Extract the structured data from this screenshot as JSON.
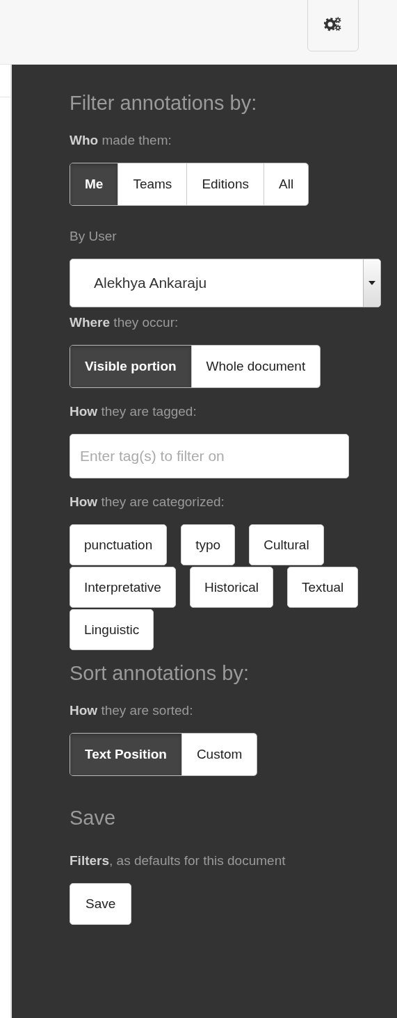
{
  "filter_heading": "Filter annotations by:",
  "who": {
    "label": "**Who** made them:",
    "options": [
      {
        "label": "Me",
        "selected": true
      },
      {
        "label": "Teams",
        "selected": false
      },
      {
        "label": "Editions",
        "selected": false
      },
      {
        "label": "All",
        "selected": false
      }
    ]
  },
  "by_user": {
    "label": "By User",
    "value": "Alekhya Ankaraju"
  },
  "where": {
    "label": "**Where** they occur:",
    "options": [
      {
        "label": "Visible portion",
        "selected": true
      },
      {
        "label": "Whole document",
        "selected": false
      }
    ]
  },
  "tagged": {
    "label": "**How** they are tagged:",
    "placeholder": "Enter tag(s) to filter on"
  },
  "categorized": {
    "label": "**How** they are categorized:",
    "tags": [
      {
        "label": "punctuation",
        "selected": false
      },
      {
        "label": "typo",
        "selected": false
      },
      {
        "label": "Cultural",
        "selected": false
      },
      {
        "label": "Interpretative",
        "selected": false
      },
      {
        "label": "Historical",
        "selected": false
      },
      {
        "label": "Textual",
        "selected": false
      },
      {
        "label": "Linguistic",
        "selected": false
      }
    ]
  },
  "sort_heading": "Sort annotations by:",
  "sorted": {
    "label": "**How** they are sorted:",
    "options": [
      {
        "label": "Text Position",
        "selected": true
      },
      {
        "label": "Custom",
        "selected": false
      }
    ]
  },
  "save_heading": "Save",
  "save": {
    "text": "**Filters**, as defaults for this document",
    "button": "Save"
  }
}
